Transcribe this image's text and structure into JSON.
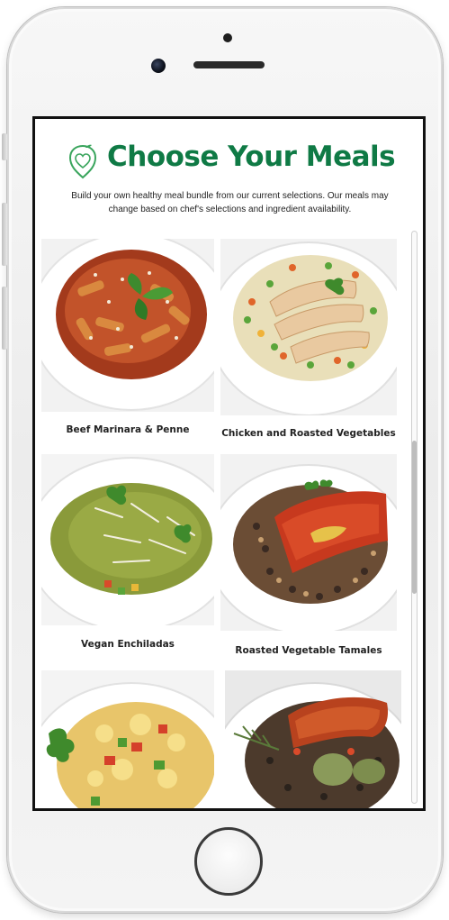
{
  "header": {
    "title": "Choose Your Meals",
    "logo_icon": "heart-leaf-logo-icon"
  },
  "intro": {
    "line1": "Build your own healthy meal bundle from our current selections. Our meals may",
    "line2": "change based on chef's selections and ingredient availability."
  },
  "meals": [
    {
      "name": "Beef Marinara & Penne"
    },
    {
      "name": "Chicken and Roasted Vegetables"
    },
    {
      "name": "Vegan Enchiladas"
    },
    {
      "name": "Roasted Vegetable Tamales"
    },
    {
      "name": ""
    },
    {
      "name": ""
    }
  ],
  "colors": {
    "brand_green": "#0f7a45",
    "text": "#222222"
  }
}
